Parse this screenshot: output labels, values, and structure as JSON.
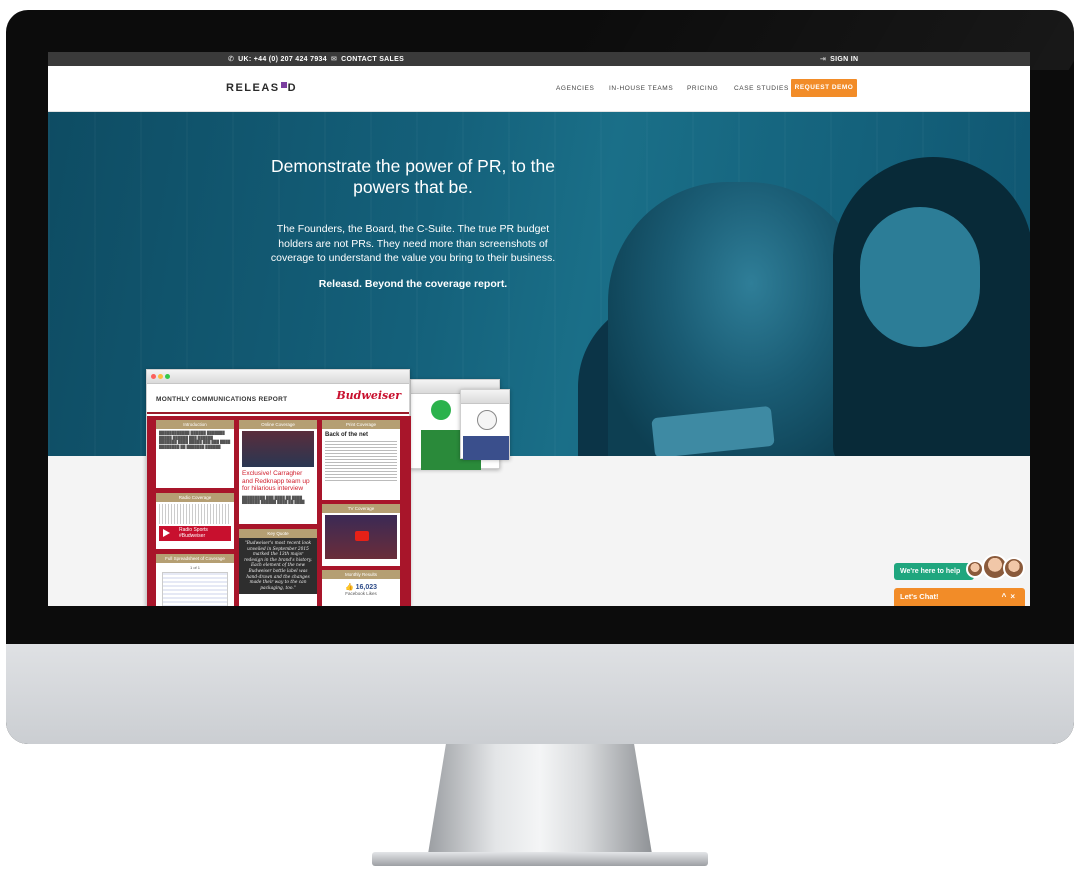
{
  "topbar": {
    "phone": "UK: +44 (0) 207 424 7934",
    "contact": "CONTACT SALES",
    "sign_in": "SIGN IN"
  },
  "nav": {
    "logo": "RELEAS D",
    "links": [
      "AGENCIES",
      "IN-HOUSE TEAMS",
      "PRICING",
      "CASE STUDIES"
    ],
    "cta": "REQUEST DEMO"
  },
  "hero": {
    "headline": "Demonstrate the power of PR, to the powers that be.",
    "body": "The Founders, the Board, the C-Suite. The true PR budget holders are not PRs. They need more than screenshots of coverage to understand the value you bring to their business.",
    "tagline": "Releasd. Beyond the coverage report."
  },
  "report": {
    "title": "MONTHLY COMMUNICATIONS REPORT",
    "brand": "Budweiser",
    "cards": {
      "intro": "Introduction",
      "online": "Online Coverage",
      "print": "Print Coverage",
      "radio": "Radio Coverage",
      "tv": "TV Coverage",
      "quotes": "Key Quote",
      "spreadsheet": "Full Spreadsheet of Coverage",
      "results": "Monthly Results"
    },
    "online_headline": "Exclusive! Carragher and Redknapp team up for hilarious interview",
    "print_headline": "Back of the net",
    "radio_label": "Radio Sports",
    "radio_sub": "#Budweiser",
    "quote": "\"Budweiser's most recent look unveiled in September 2015 marked the 13th major redesign in the brand's history. Each element of the new Budweiser bottle label was hand-drawn and the changes made their way to the can packaging, too.\"",
    "likes_value": "16,023",
    "likes_label": "Facebook Likes",
    "page_indicator": "1 of 1"
  },
  "chat": {
    "help": "We're here to help",
    "bar": "Let's Chat!",
    "controls": "^ ×"
  },
  "colors": {
    "accent": "#f28c28",
    "hero": "#14607a",
    "brand_red": "#a8152a",
    "chat_green": "#1fa67e"
  }
}
